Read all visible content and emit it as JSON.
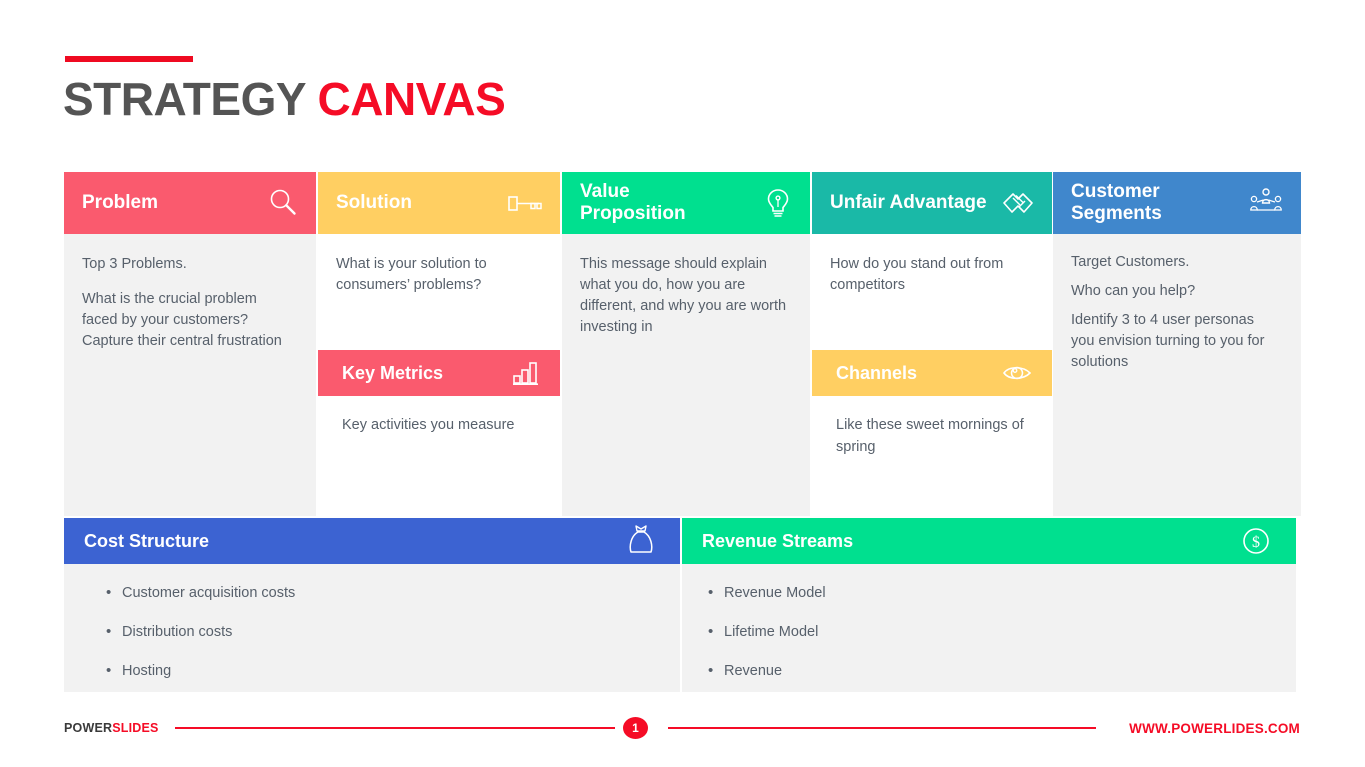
{
  "title": {
    "part1": "STRATEGY",
    "part2": "CANVAS",
    "accent_color": "#f50c26",
    "dark_color": "#545454"
  },
  "canvas": {
    "columns": [
      {
        "header": {
          "label": "Problem",
          "icon": "magnifier-icon",
          "color": "#fa5a6e"
        },
        "body": [
          "Top 3 Problems.",
          "What is the crucial problem faced by your customers? Capture their central frustration"
        ]
      },
      {
        "header": {
          "label": "Solution",
          "icon": "key-icon",
          "color": "#ffcf62"
        },
        "body": [
          "What is your solution to consumers’ problems?"
        ],
        "sub": {
          "header": {
            "label": "Key Metrics",
            "icon": "bar-chart-icon",
            "color": "#fa5a6e"
          },
          "body": "Key activities you measure"
        }
      },
      {
        "header": {
          "label": "Value\nProposition",
          "icon": "lightbulb-icon",
          "color": "#00e08f"
        },
        "body": [
          "This message should explain what you do, how you are different, and why you are worth investing in"
        ]
      },
      {
        "header": {
          "label": "Unfair Advantage",
          "icon": "handshake-icon",
          "color": "#1ab9a7"
        },
        "body": [
          "How do you stand out from competitors"
        ],
        "sub": {
          "header": {
            "label": "Channels",
            "icon": "eye-icon",
            "color": "#ffcf62"
          },
          "body": "Like these sweet mornings of spring"
        }
      },
      {
        "header": {
          "label": "Customer\nSegments",
          "icon": "people-network-icon",
          "color": "#4087cc"
        },
        "body": [
          "Target Customers.",
          "Who can you help?",
          "Identify 3 to 4 user personas you envision turning to you for solutions"
        ]
      }
    ]
  },
  "bottom": {
    "cost": {
      "header": {
        "label": "Cost Structure",
        "icon": "money-bag-icon",
        "color": "#3c63d2"
      },
      "items": [
        "Customer acquisition costs",
        "Distribution costs",
        "Hosting"
      ]
    },
    "revenue": {
      "header": {
        "label": "Revenue Streams",
        "icon": "dollar-circle-icon",
        "color": "#00e08f"
      },
      "items": [
        "Revenue Model",
        "Lifetime Model",
        "Revenue"
      ]
    }
  },
  "footer": {
    "brand_part1": "POWER",
    "brand_part2": "SLIDES",
    "page_number": "1",
    "url": "WWW.POWERLIDES.COM"
  }
}
